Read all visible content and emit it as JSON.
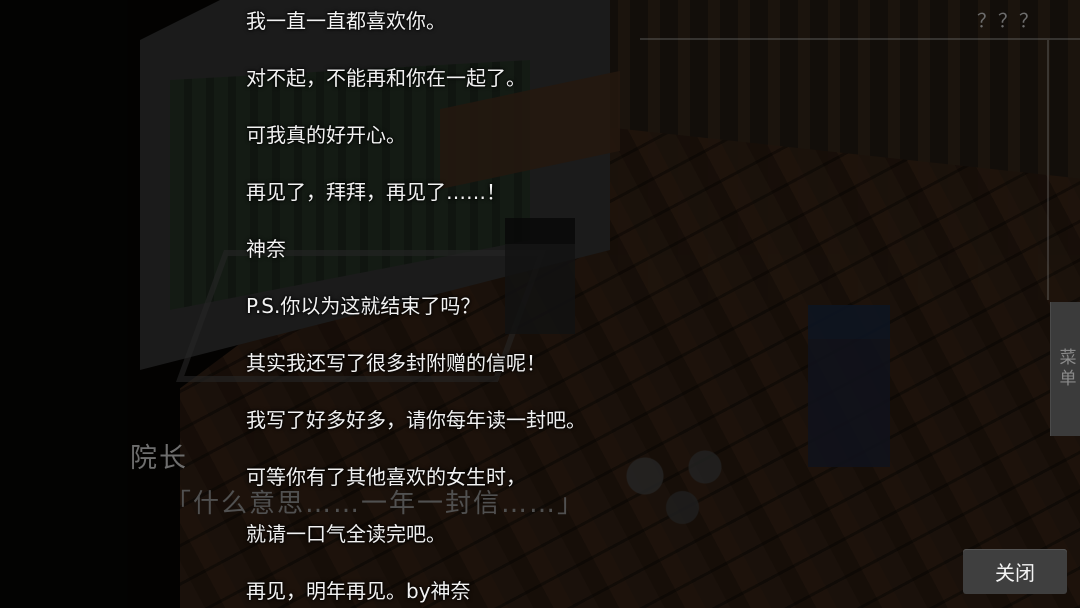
{
  "hud": {
    "unknown_label": "？？？",
    "menu_label": "菜单"
  },
  "background_dialogue": {
    "speaker": "院长",
    "line": "「什么意思……一年一封信……」"
  },
  "letter": {
    "lines": [
      "我一直一直都喜欢你。",
      "对不起，不能再和你在一起了。",
      "可我真的好开心。",
      "再见了，拜拜，再见了……！",
      "神奈",
      "P.S.你以为这就结束了吗？",
      "其实我还写了很多封附赠的信呢！",
      "我写了好多好多，请你每年读一封吧。",
      "可等你有了其他喜欢的女生时，",
      "就请一口气全读完吧。",
      "再见，明年再见。by神奈"
    ]
  },
  "buttons": {
    "close_label": "关闭"
  }
}
